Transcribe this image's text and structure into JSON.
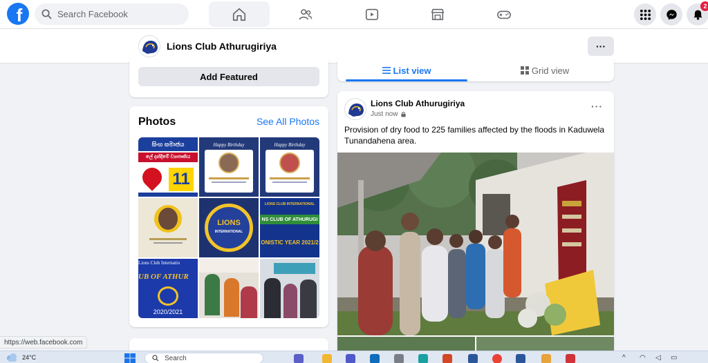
{
  "topnav": {
    "logo_letter": "f",
    "search_placeholder": "Search Facebook",
    "tabs": [
      "home",
      "friends",
      "watch",
      "marketplace",
      "gaming"
    ],
    "notification_count": "2"
  },
  "page_header": {
    "name": "Lions Club Athurugiriya",
    "more_label": "···"
  },
  "featured": {
    "add_label": "Add Featured"
  },
  "photos": {
    "title": "Photos",
    "see_all": "See All Photos",
    "tiles": [
      {
        "caption_top": "සිංහ සමාජය",
        "caption_mid": "ලේ දන්දීමේ ව්‍යාපෘතිය",
        "date": "11"
      },
      {
        "caption_top": "Happy Birthday"
      },
      {
        "caption_top": "Happy Birthday"
      },
      {
        "caption_top": ""
      },
      {
        "caption_top": "LIONS",
        "caption_mid": "INTERNATIONAL"
      },
      {
        "caption_top": "LIONS CLUB INTERNATIONAL",
        "caption_mid": "NS CLUB OF ATHURUGI",
        "caption_bottom": "ONISTIC YEAR 2021/2"
      },
      {
        "caption_top": "Lions Club Internatio",
        "caption_mid": "UB OF ATHUR",
        "caption_bottom": "2020/2021"
      },
      {
        "caption_top": ""
      },
      {
        "caption_top": ""
      }
    ]
  },
  "feed_tabs": {
    "list_view": "List view",
    "grid_view": "Grid view"
  },
  "post": {
    "author": "Lions Club Athurugiriya",
    "time": "Just now",
    "more_label": "···",
    "text": "Provision of dry food to 225 families affected by the floods in Kaduwela Tunandahena area."
  },
  "status_url": "https://web.facebook.com",
  "taskbar": {
    "temperature": "24°C",
    "search_placeholder": "Search"
  },
  "colors": {
    "brand": "#1877f2",
    "background": "#f0f2f5",
    "badge": "#e41e3f"
  }
}
